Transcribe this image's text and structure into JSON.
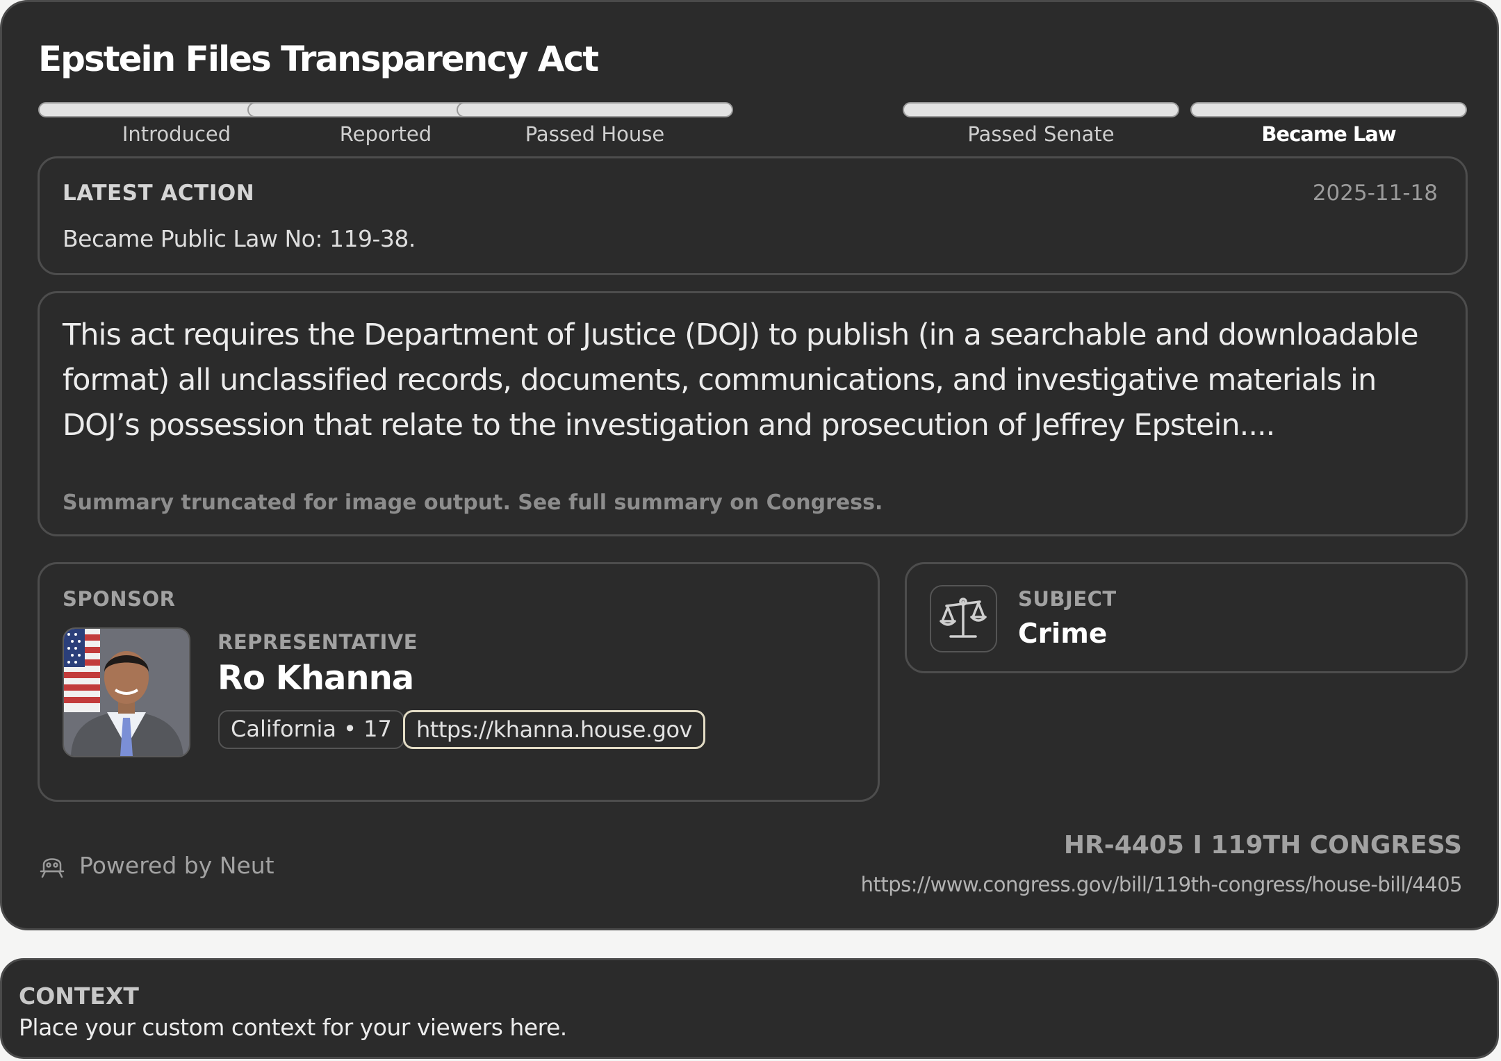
{
  "bill": {
    "title": "Epstein Files Transparency Act",
    "id_label": "HR-4405 I 119TH CONGRESS",
    "url": "https://www.congress.gov/bill/119th-congress/house-bill/4405"
  },
  "progress": {
    "steps": [
      {
        "label": "Introduced",
        "state": "complete"
      },
      {
        "label": "Reported",
        "state": "complete"
      },
      {
        "label": "Passed House",
        "state": "complete"
      },
      {
        "label": "Passed Senate",
        "state": "complete"
      },
      {
        "label": "Became Law",
        "state": "current"
      }
    ]
  },
  "latest_action": {
    "heading": "LATEST ACTION",
    "date": "2025-11-18",
    "text": "Became Public Law No: 119-38."
  },
  "summary": {
    "text": "This act requires the Department of Justice (DOJ) to publish (in a searchable and downloadable format) all unclassified records, documents, communications, and investigative materials in DOJ’s possession that relate to the investigation and prosecution of Jeffrey Epstein....",
    "note": "Summary truncated for image output. See full summary on Congress."
  },
  "sponsor": {
    "heading": "SPONSOR",
    "role": "REPRESENTATIVE",
    "name": "Ro Khanna",
    "district": "California • 17",
    "website": "https://khanna.house.gov"
  },
  "subject": {
    "heading": "SUBJECT",
    "value": "Crime",
    "icon": "scales-icon"
  },
  "footer": {
    "powered_by": "Powered by Neut",
    "icon": "neut-logo-icon"
  },
  "context": {
    "heading": "CONTEXT",
    "text": "Place your custom context for your viewers here."
  },
  "colors": {
    "card_background": "#2b2b2b",
    "border": "#4d4d4d",
    "progress_fill": "#e2e2e2",
    "link_outline": "#e3dcc5",
    "page_background": "#f5f5f4"
  }
}
